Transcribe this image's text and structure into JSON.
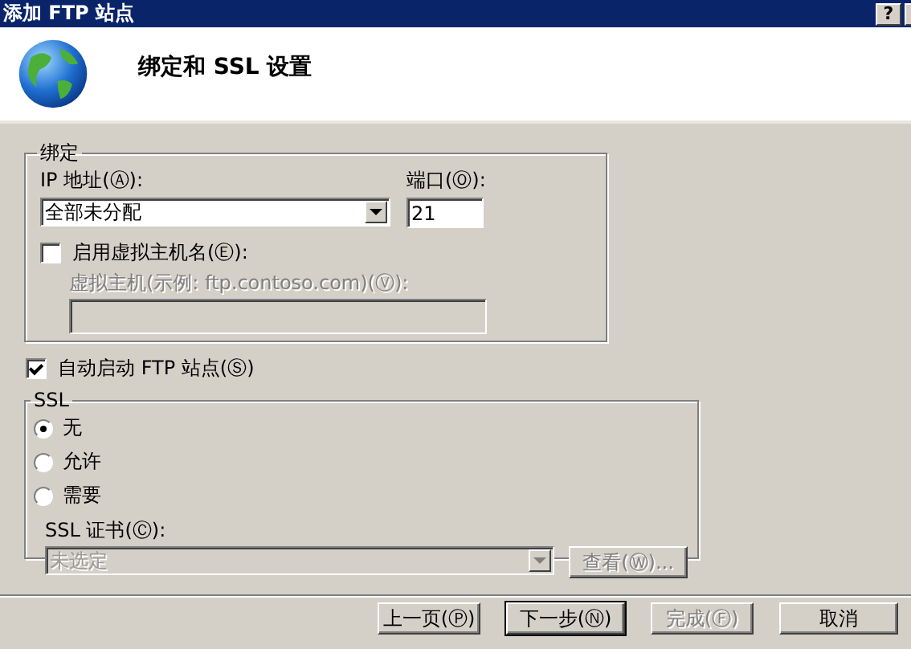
{
  "window": {
    "title": "添加 FTP 站点",
    "help_button": "?"
  },
  "header": {
    "title": "绑定和 SSL 设置"
  },
  "binding": {
    "legend": "绑定",
    "ip_label": "IP 地址(Ⓐ):",
    "ip_value": "全部未分配",
    "port_label": "端口(Ⓞ):",
    "port_value": "21",
    "virtual_host": {
      "label": "启用虚拟主机名(Ⓔ):",
      "checked": false,
      "field_label": "虚拟主机(示例: ftp.contoso.com)(Ⓥ):"
    }
  },
  "auto_start": {
    "label": "自动启动 FTP 站点(Ⓢ)",
    "checked": true
  },
  "ssl": {
    "legend": "SSL",
    "options": [
      {
        "label": "无",
        "selected": true
      },
      {
        "label": "允许",
        "selected": false
      },
      {
        "label": "需要",
        "selected": false
      }
    ],
    "cert_label": "SSL 证书(Ⓒ):",
    "cert_value": "未选定",
    "view_button": {
      "label": "查看(Ⓦ)...",
      "disabled": true
    }
  },
  "buttons": [
    {
      "label": "上一页(Ⓟ)",
      "disabled": false,
      "default": false
    },
    {
      "label": "下一步(Ⓝ)",
      "disabled": false,
      "default": true
    },
    {
      "label": "完成(Ⓕ)",
      "disabled": true,
      "default": false
    },
    {
      "label": "取消",
      "disabled": false,
      "default": false
    }
  ]
}
